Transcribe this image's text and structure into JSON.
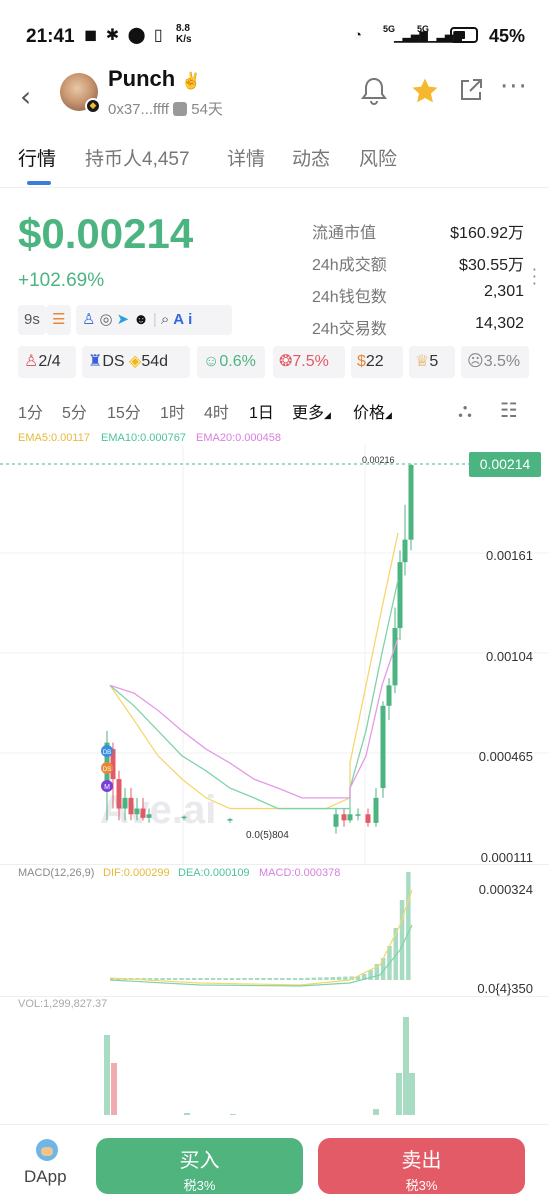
{
  "status_bar": {
    "time": "21:41",
    "speed_value": "8.8",
    "speed_unit": "K/s",
    "battery": "45%",
    "signal_left": "5G",
    "signal_right": "5G"
  },
  "header": {
    "name": "Punch",
    "address": "0x37...ffff",
    "age": "54天"
  },
  "tabs": [
    "行情",
    "持币人4,457",
    "详情",
    "动态",
    "风险"
  ],
  "price": {
    "value": "$0.00214",
    "change": "+102.69%"
  },
  "stats": [
    {
      "label": "流通市值",
      "value": "$160.92万"
    },
    {
      "label": "24h成交额",
      "value": "$30.55万"
    },
    {
      "label": "24h钱包数",
      "value": "2,301"
    },
    {
      "label": "24h交易数",
      "value": "14,302"
    }
  ],
  "chips": {
    "age": "9s"
  },
  "pills": {
    "holders_ratio": "2/4",
    "ds": "DS",
    "days": "54d",
    "top10": "0.6%",
    "bundle": "7.5%",
    "snipers": "22",
    "insiders": "5",
    "dev": "3.5%"
  },
  "timeframes": [
    "1分",
    "5分",
    "15分",
    "1时",
    "4时",
    "1日",
    "更多",
    "价格"
  ],
  "ema": {
    "ema5": "EMA5:0.00117",
    "ema10": "EMA10:0.000767",
    "ema20": "EMA20:0.000458"
  },
  "price_axis": [
    "0.00161",
    "0.00104",
    "0.000465",
    "0.000111"
  ],
  "current_price_tag": "0.00214",
  "high_label": "0.00216",
  "low_label": "0.0(5)804",
  "macd": {
    "title": "MACD(12,26,9)",
    "dif": "DIF:0.000299",
    "dea": "DEA:0.000109",
    "macd": "MACD:0.000378",
    "axis_top": "0.000324",
    "axis_bottom": "0.0{4}350"
  },
  "vol": {
    "title": "VOL:1,299,827.37"
  },
  "markers": [
    "DB",
    "DS",
    "M"
  ],
  "watermark": "Ave.ai",
  "bottom": {
    "dapp": "DApp",
    "buy": "买入",
    "buy_tax": "税3%",
    "sell": "卖出",
    "sell_tax": "税3%"
  },
  "colors": {
    "up": "#4cb480",
    "down": "#e05b66",
    "ema5": "#f5d76e",
    "ema10": "#7ed3a8",
    "ema20": "#e39be6",
    "buy": "#4fb47e",
    "sell": "#e35b66",
    "tab_active": "#3b7ddd"
  },
  "chart_data": {
    "type": "line",
    "series": [
      {
        "name": "EMA5",
        "values": [
          0.0003,
          0.00022,
          0.00016,
          0.00013,
          0.00011,
          0.0001,
          0.0001,
          0.0001,
          0.0001,
          0.0001,
          0.00011,
          0.00015,
          0.0003,
          0.0006,
          0.00117
        ]
      },
      {
        "name": "EMA10",
        "values": [
          0.0003,
          0.00025,
          0.0002,
          0.00016,
          0.00014,
          0.00012,
          0.00011,
          0.0001,
          0.0001,
          0.0001,
          0.0001,
          0.00012,
          0.0002,
          0.0004,
          0.000767
        ]
      },
      {
        "name": "EMA20",
        "values": [
          0.0003,
          0.00028,
          0.00024,
          0.0002,
          0.00017,
          0.00015,
          0.00013,
          0.00012,
          0.00011,
          0.00011,
          0.00011,
          0.00012,
          0.00016,
          0.0003,
          0.000458
        ]
      }
    ],
    "xlabel": "",
    "ylabel": ""
  }
}
